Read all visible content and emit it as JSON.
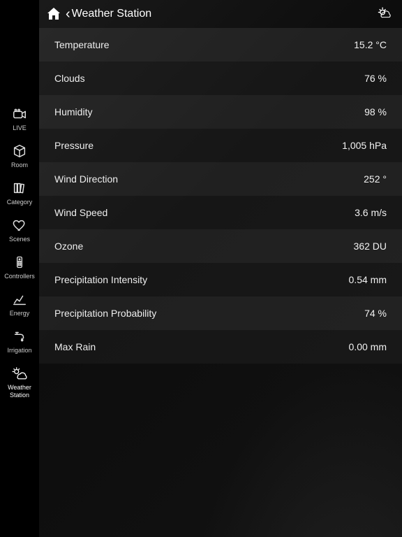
{
  "header": {
    "title": "Weather Station"
  },
  "sidebar": {
    "items": [
      {
        "label": "LIVE",
        "icon": "recorder-icon",
        "active": false
      },
      {
        "label": "Room",
        "icon": "box-icon",
        "active": false
      },
      {
        "label": "Category",
        "icon": "books-icon",
        "active": false
      },
      {
        "label": "Scenes",
        "icon": "heart-icon",
        "active": false
      },
      {
        "label": "Controllers",
        "icon": "remote-icon",
        "active": false
      },
      {
        "label": "Energy",
        "icon": "chart-icon",
        "active": false
      },
      {
        "label": "Irrigation",
        "icon": "faucet-icon",
        "active": false
      },
      {
        "label": "Weather Station",
        "icon": "weather-icon",
        "active": true
      }
    ]
  },
  "readings": [
    {
      "label": "Temperature",
      "value": "15.2 °C"
    },
    {
      "label": "Clouds",
      "value": "76 %"
    },
    {
      "label": "Humidity",
      "value": "98 %"
    },
    {
      "label": "Pressure",
      "value": "1,005 hPa"
    },
    {
      "label": "Wind Direction",
      "value": "252 °"
    },
    {
      "label": "Wind Speed",
      "value": "3.6 m/s"
    },
    {
      "label": "Ozone",
      "value": "362 DU"
    },
    {
      "label": "Precipitation Intensity",
      "value": "0.54 mm"
    },
    {
      "label": "Precipitation Probability",
      "value": "74 %"
    },
    {
      "label": "Max Rain",
      "value": "0.00 mm"
    }
  ]
}
